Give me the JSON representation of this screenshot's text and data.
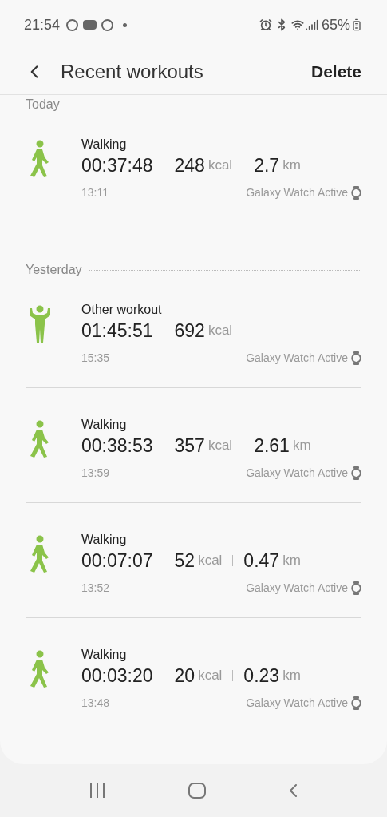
{
  "status_bar": {
    "time": "21:54",
    "battery": "65%"
  },
  "header": {
    "title": "Recent workouts",
    "action": "Delete"
  },
  "sections": [
    {
      "label": "Today",
      "workouts": [
        {
          "kind": "walking",
          "name": "Walking",
          "duration": "00:37:48",
          "stats": [
            {
              "value": "248",
              "unit": "kcal"
            },
            {
              "value": "2.7",
              "unit": "km"
            }
          ],
          "time": "13:11",
          "device": "Galaxy Watch Active"
        }
      ]
    },
    {
      "label": "Yesterday",
      "workouts": [
        {
          "kind": "other",
          "name": "Other workout",
          "duration": "01:45:51",
          "stats": [
            {
              "value": "692",
              "unit": "kcal"
            }
          ],
          "time": "15:35",
          "device": "Galaxy Watch Active"
        },
        {
          "kind": "walking",
          "name": "Walking",
          "duration": "00:38:53",
          "stats": [
            {
              "value": "357",
              "unit": "kcal"
            },
            {
              "value": "2.61",
              "unit": "km"
            }
          ],
          "time": "13:59",
          "device": "Galaxy Watch Active"
        },
        {
          "kind": "walking",
          "name": "Walking",
          "duration": "00:07:07",
          "stats": [
            {
              "value": "52",
              "unit": "kcal"
            },
            {
              "value": "0.47",
              "unit": "km"
            }
          ],
          "time": "13:52",
          "device": "Galaxy Watch Active"
        },
        {
          "kind": "walking",
          "name": "Walking",
          "duration": "00:03:20",
          "stats": [
            {
              "value": "20",
              "unit": "kcal"
            },
            {
              "value": "0.23",
              "unit": "km"
            }
          ],
          "time": "13:48",
          "device": "Galaxy Watch Active"
        }
      ]
    }
  ]
}
